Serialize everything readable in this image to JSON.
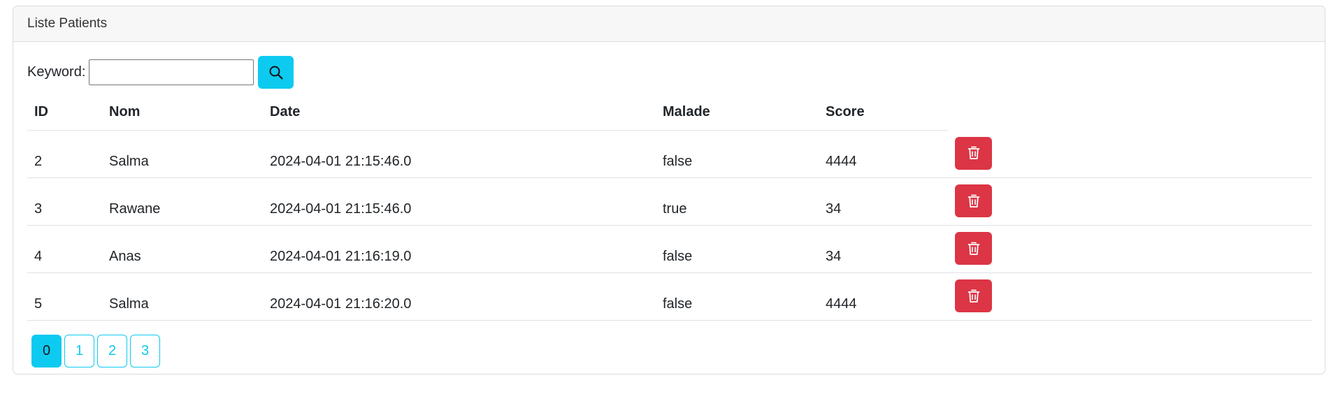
{
  "card": {
    "title": "Liste Patients"
  },
  "search": {
    "label": "Keyword:",
    "value": "",
    "button_icon": "search-icon"
  },
  "table": {
    "headers": [
      "ID",
      "Nom",
      "Date",
      "Malade",
      "Score"
    ],
    "rows": [
      {
        "id": "2",
        "nom": "Salma",
        "date": "2024-04-01 21:15:46.0",
        "malade": "false",
        "score": "4444"
      },
      {
        "id": "3",
        "nom": "Rawane",
        "date": "2024-04-01 21:15:46.0",
        "malade": "true",
        "score": "34"
      },
      {
        "id": "4",
        "nom": "Anas",
        "date": "2024-04-01 21:16:19.0",
        "malade": "false",
        "score": "34"
      },
      {
        "id": "5",
        "nom": "Salma",
        "date": "2024-04-01 21:16:20.0",
        "malade": "false",
        "score": "4444"
      }
    ],
    "delete_icon": "trash-icon"
  },
  "pagination": {
    "pages": [
      "0",
      "1",
      "2",
      "3"
    ],
    "current": "0"
  },
  "colors": {
    "accent": "#0dcaf0",
    "danger": "#dc3545",
    "header_bg": "#f7f7f7",
    "border": "#dee2e6"
  }
}
